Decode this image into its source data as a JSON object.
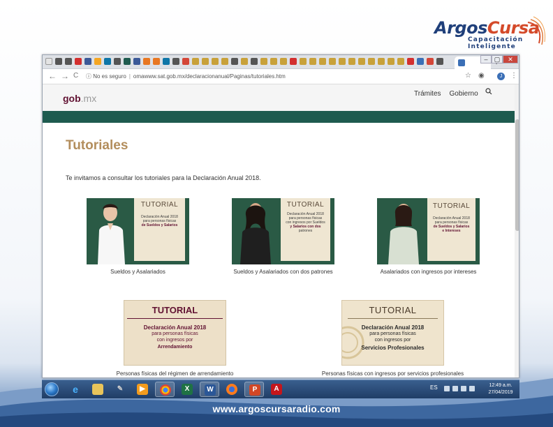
{
  "logo": {
    "name_part1": "Argos",
    "name_part2": "Cursa",
    "tagline1": "Capacitación",
    "tagline2": "Inteligente"
  },
  "browser": {
    "active_tab_close": "×",
    "new_tab": "+",
    "window_controls": [
      "–",
      "▢",
      "✕"
    ],
    "toolbar": {
      "back": "←",
      "forward": "→",
      "reload": "C",
      "security": "No es seguro",
      "url": "omawww.sat.gob.mx/declaracionanual/Paginas/tutoriales.htm",
      "profile_initial": "J",
      "menu": "⋮"
    }
  },
  "site": {
    "brand": "gob",
    "brand_tld": ".mx",
    "nav": [
      "Trámites",
      "Gobierno"
    ],
    "search_icon": "magnifier",
    "page_title": "Tutoriales",
    "intro": "Te invitamos a consultar los tutoriales para la Declaración Anual 2018."
  },
  "tutorials": [
    {
      "panel_title": "TUTORIAL",
      "panel_lines": [
        "Declaración Anual 2018",
        "para personas físicas",
        "de Sueldos y Salarios"
      ],
      "caption": "Sueldos y Asalariados"
    },
    {
      "panel_title": "TUTORIAL",
      "panel_lines": [
        "Declaración Anual 2018",
        "para personas físicas",
        "con ingresos por Sueldos",
        "y Salarios con dos",
        "patrones"
      ],
      "caption": "Sueldos y Asalariados con dos patrones"
    },
    {
      "panel_title": "TUTORIAL",
      "panel_lines": [
        "Declaración Anual 2018",
        "para personas físicas",
        "de Sueldos y Salarios",
        "e Intereses"
      ],
      "caption": "Asalariados con ingresos por intereses"
    },
    {
      "panel_title": "TUTORIAL",
      "panel_lines": [
        "Declaración Anual 2018",
        "para personas físicas",
        "con ingresos por",
        "Arrendamiento"
      ],
      "caption": "Personas físicas del régimen de arrendamiento"
    },
    {
      "panel_title": "TUTORIAL",
      "panel_lines": [
        "Declaración Anual 2018",
        "para personas físicas",
        "con ingresos por",
        "Servicios Profesionales"
      ],
      "caption": "Personas físicas con ingresos por servicios profesionales"
    }
  ],
  "taskbar": {
    "apps": [
      "start",
      "internet-explorer",
      "file-explorer",
      "media",
      "media-player",
      "chrome",
      "excel",
      "word",
      "firefox",
      "powerpoint",
      "acrobat"
    ],
    "lang": "ES",
    "time": "12:49 a.m.",
    "date": "27/04/2019"
  },
  "footer": {
    "url": "www.argoscursaradio.com"
  },
  "colors": {
    "gob_green": "#1e5b4f",
    "gob_wine": "#611232",
    "gob_gold": "#b38e5d"
  }
}
